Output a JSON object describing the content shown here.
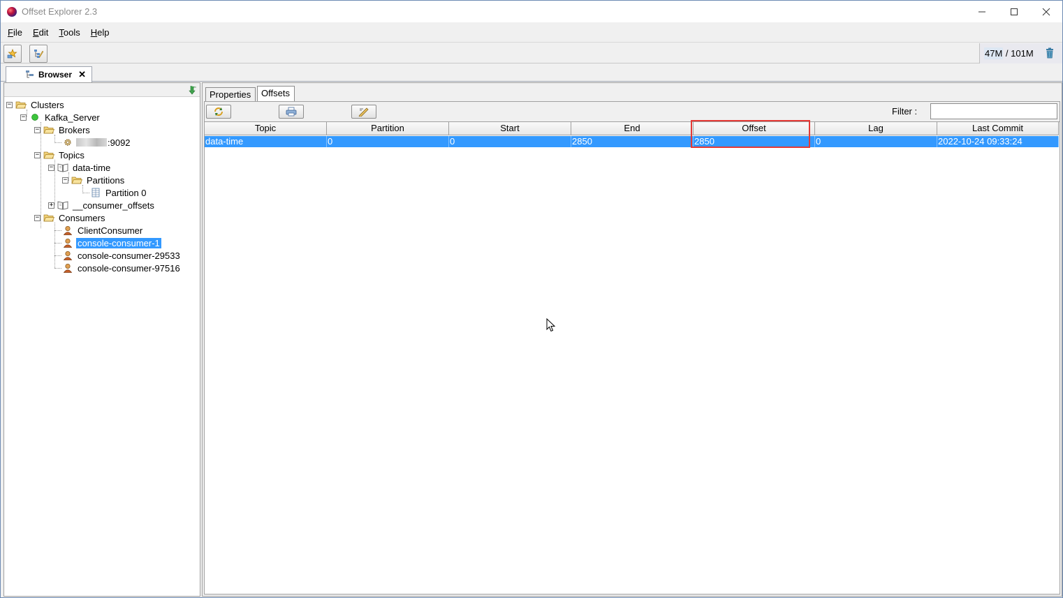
{
  "window": {
    "title": "Offset Explorer  2.3"
  },
  "menu": [
    {
      "mnemonic": "F",
      "rest": "ile"
    },
    {
      "mnemonic": "E",
      "rest": "dit"
    },
    {
      "mnemonic": "T",
      "rest": "ools"
    },
    {
      "mnemonic": "H",
      "rest": "elp"
    }
  ],
  "memory": {
    "used": "47M",
    "separator": " / ",
    "total": "101M"
  },
  "browser_tab": {
    "label": "Browser"
  },
  "tree": {
    "clusters": "Clusters",
    "server": "Kafka_Server",
    "brokers": "Brokers",
    "broker_port": ":9092",
    "topics": "Topics",
    "topic_data_time": "data-time",
    "partitions": "Partitions",
    "partition0": "Partition 0",
    "consumer_offsets": "__consumer_offsets",
    "consumers": "Consumers",
    "consumer_list": [
      "ClientConsumer",
      "console-consumer-1",
      "console-consumer-29533",
      "console-consumer-97516"
    ]
  },
  "subtabs": {
    "properties": "Properties",
    "offsets": "Offsets"
  },
  "filter": {
    "label": "Filter :",
    "value": ""
  },
  "table": {
    "columns": [
      "Topic",
      "Partition",
      "Start",
      "End",
      "Offset",
      "Lag",
      "Last Commit"
    ],
    "rows": [
      [
        "data-time",
        "0",
        "0",
        "2850",
        "2850",
        "0",
        "2022-10-24 09:33:24"
      ]
    ]
  },
  "colors": {
    "selection": "#3399ff",
    "highlight": "#e53935"
  }
}
